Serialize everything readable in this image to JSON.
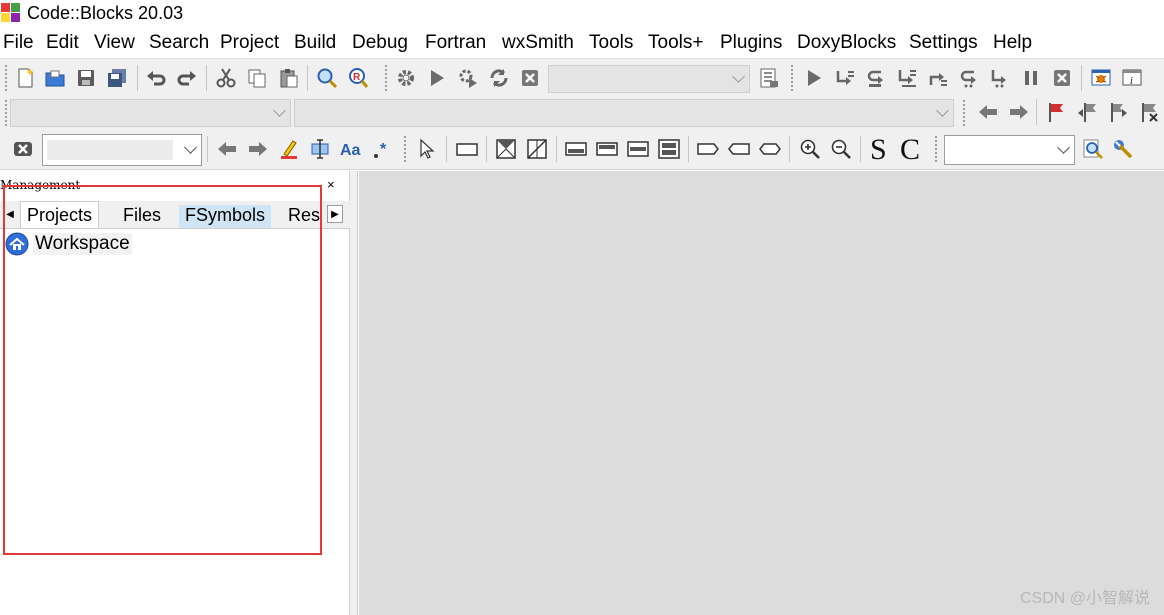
{
  "window": {
    "title": "Code::Blocks 20.03"
  },
  "menu": [
    "File",
    "Edit",
    "View",
    "Search",
    "Project",
    "Build",
    "Debug",
    "Fortran",
    "wxSmith",
    "Tools",
    "Tools+",
    "Plugins",
    "DoxyBlocks",
    "Settings",
    "Help"
  ],
  "toolbar3": {
    "letter_s": "S",
    "letter_c": "C"
  },
  "management": {
    "title": "Management",
    "close": "×",
    "tabs": [
      "Projects",
      "Files",
      "FSymbols",
      "Res"
    ],
    "active_tab": "Projects",
    "tree_root": "Workspace"
  },
  "watermark": "CSDN @小智解说",
  "colors": {
    "annotation_box": "#e53935",
    "editor_bg": "#dcdcdc",
    "toolbar_bg": "#f0f0f0",
    "tab_highlight": "#cfe5f5"
  }
}
